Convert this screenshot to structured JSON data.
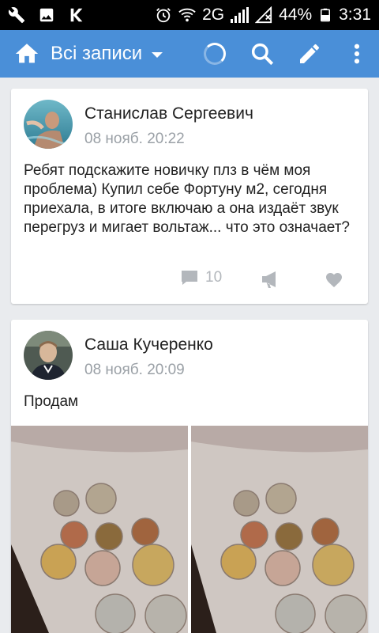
{
  "status_bar": {
    "network": "2G",
    "battery": "44%",
    "time": "3:31"
  },
  "app_bar": {
    "title": "Всі записи"
  },
  "posts": [
    {
      "author": "Станислав Сергеевич",
      "time": "08 нояб. 20:22",
      "text": "Ребят подскажите новичку плз в чём моя проблема) Купил себе Фортуну м2, сегодня приехала, в итоге включаю а она издаёт звук перегруз и мигает вольтаж... что это означает?",
      "comments": "10"
    },
    {
      "author": "Саша Кучеренко",
      "time": "08 нояб. 20:09",
      "text": "Продам"
    }
  ],
  "colors": {
    "app_bar": "#4a8fd8",
    "background": "#e9ebee",
    "muted_icon": "#b3b7bc"
  }
}
